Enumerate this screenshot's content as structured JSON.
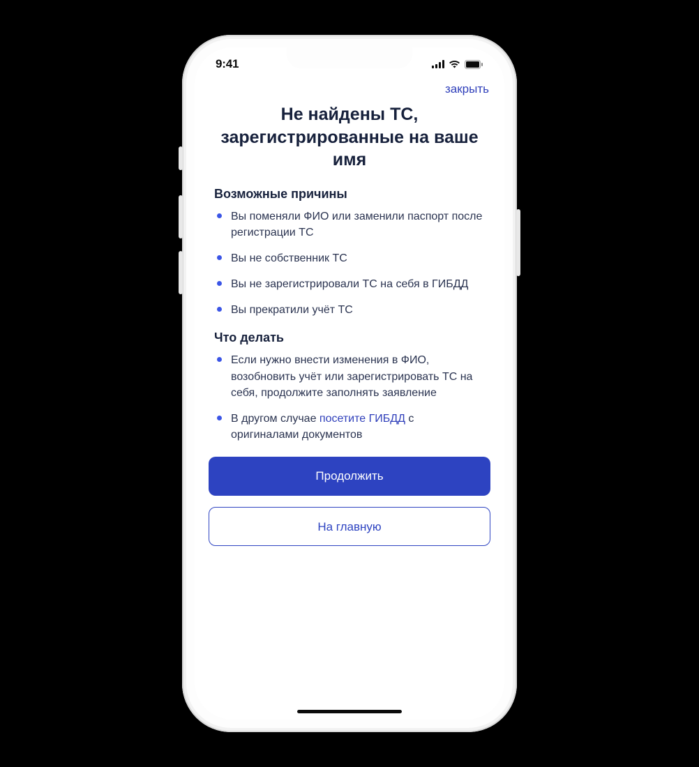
{
  "status_bar": {
    "time": "9:41"
  },
  "header": {
    "close": "закрыть"
  },
  "page": {
    "title": "Не найдены ТС, зарегистрированные на ваше имя"
  },
  "sections": {
    "reasons": {
      "heading": "Возможные причины",
      "items": [
        "Вы поменяли ФИО или заменили паспорт после регистрации ТС",
        "Вы не собственник ТС",
        "Вы не зарегистрировали ТС на себя в ГИБДД",
        "Вы прекратили учёт ТС"
      ]
    },
    "actions": {
      "heading": "Что делать",
      "items": [
        {
          "text": "Если нужно внести изменения в ФИО, возобновить учёт или зарегистрировать ТС на себя, продолжите заполнять заявление"
        },
        {
          "prefix": "В другом случае ",
          "link": "посетите ГИБДД",
          "suffix": " с оригиналами документов"
        }
      ]
    }
  },
  "buttons": {
    "continue": "Продолжить",
    "home": "На главную"
  },
  "colors": {
    "primary": "#2d43c1",
    "text": "#17213c"
  }
}
